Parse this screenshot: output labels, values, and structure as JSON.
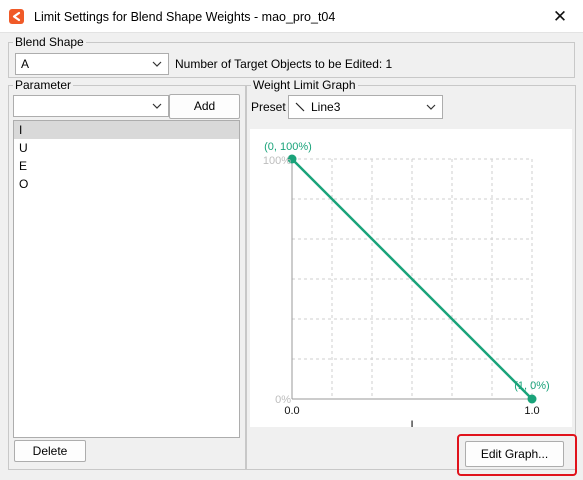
{
  "window": {
    "title": "Limit Settings for Blend Shape Weights - mao_pro_t04",
    "close_glyph": "✕"
  },
  "blend_shape": {
    "group_label": "Blend Shape",
    "selected": "A",
    "target_info": "Number of Target Objects to be Edited: 1"
  },
  "parameter": {
    "group_label": "Parameter",
    "combo_value": "",
    "add_label": "Add",
    "items": [
      "I",
      "U",
      "E",
      "O"
    ],
    "selected_index": 0,
    "delete_label": "Delete"
  },
  "graph": {
    "group_label": "Weight Limit Graph",
    "preset_label": "Preset",
    "preset_icon": "diagonal-line-icon",
    "preset_value": "Line3",
    "y_top_label": "100%",
    "y_bottom_label": "0%",
    "x_left_label": "0.0",
    "x_right_label": "1.0",
    "x_axis_label": "I",
    "point_start_label": "(0, 100%)",
    "point_end_label": "(1, 0%)",
    "edit_label": "Edit Graph...",
    "line_color": "#1aa37a",
    "highlight_color": "#e0121b"
  },
  "chart_data": {
    "type": "line",
    "x": [
      0,
      1
    ],
    "y": [
      100,
      0
    ],
    "xlim": [
      0,
      1
    ],
    "ylim": [
      0,
      100
    ],
    "xlabel": "I",
    "grid": true
  }
}
